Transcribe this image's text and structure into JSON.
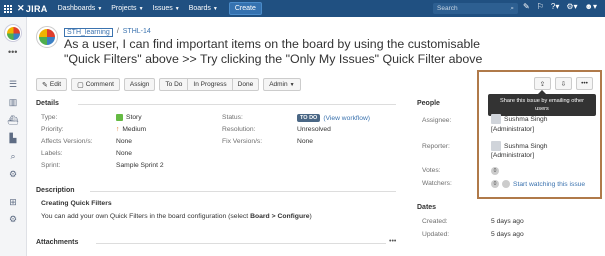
{
  "topbar": {
    "logo": "JIRA",
    "nav": [
      {
        "label": "Dashboards"
      },
      {
        "label": "Projects"
      },
      {
        "label": "Issues"
      },
      {
        "label": "Boards"
      }
    ],
    "create_label": "Create",
    "search_placeholder": "Search"
  },
  "issue": {
    "project": "STH_learning",
    "key": "STHL-14",
    "title": "As a user, I can find important items on the board by using the customisable \"Quick Filters\" above >> Try clicking the \"Only My Issues\" Quick Filter above"
  },
  "actions": {
    "edit": "Edit",
    "comment": "Comment",
    "assign": "Assign",
    "todo": "To Do",
    "in_progress": "In Progress",
    "done": "Done",
    "admin": "Admin"
  },
  "tooltip": "Share this issue by emailing other users",
  "details": {
    "heading": "Details",
    "type_label": "Type:",
    "type_value": "Story",
    "priority_label": "Priority:",
    "priority_value": "Medium",
    "affects_label": "Affects Version/s:",
    "affects_value": "None",
    "labels_label": "Labels:",
    "labels_value": "None",
    "sprint_label": "Sprint:",
    "sprint_value": "Sample Sprint 2",
    "status_label": "Status:",
    "status_value": "TO DO",
    "status_link": "(View workflow)",
    "resolution_label": "Resolution:",
    "resolution_value": "Unresolved",
    "fix_label": "Fix Version/s:",
    "fix_value": "None"
  },
  "description": {
    "heading": "Description",
    "subheading": "Creating Quick Filters",
    "text_pre": "You can add your own Quick Filters in the board configuration (select ",
    "text_bold": "Board > Configure",
    "text_post": ")"
  },
  "attachments": {
    "heading": "Attachments"
  },
  "people": {
    "heading": "People",
    "assignee_label": "Assignee:",
    "assignee_name": "Sushma Singh",
    "assignee_role": "[Administrator]",
    "reporter_label": "Reporter:",
    "reporter_name": "Sushma Singh",
    "reporter_role": "[Administrator]",
    "votes_label": "Votes:",
    "votes_count": "0",
    "watchers_label": "Watchers:",
    "watchers_count": "0",
    "watch_link": "Start watching this issue"
  },
  "dates": {
    "heading": "Dates",
    "created_label": "Created:",
    "created_value": "5 days ago",
    "updated_label": "Updated:",
    "updated_value": "5 days ago"
  }
}
